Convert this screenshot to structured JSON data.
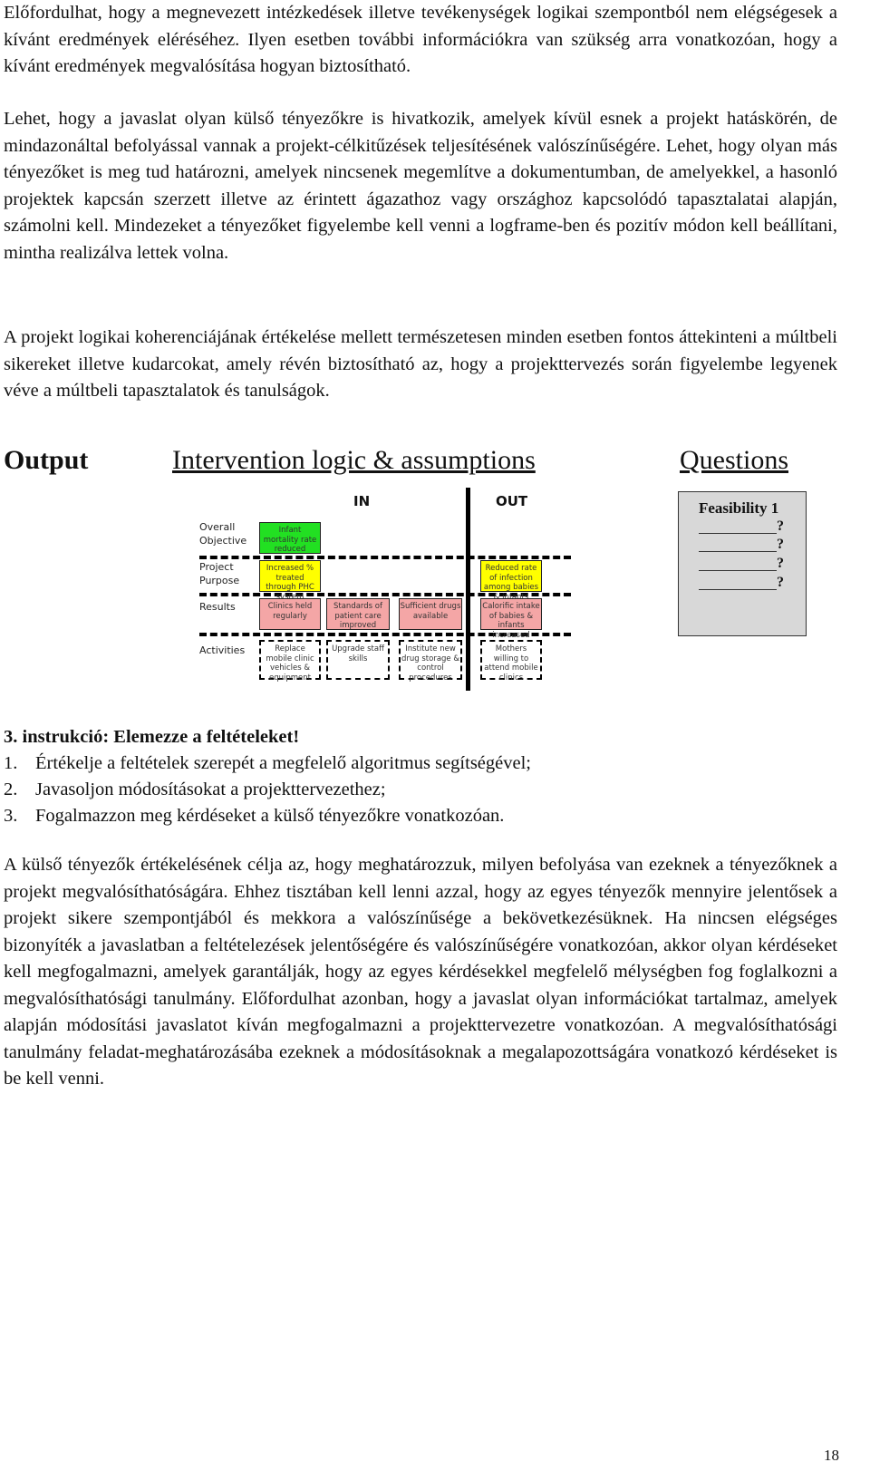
{
  "paragraphs": [
    "Előfordulhat, hogy a megnevezett intézkedések illetve tevékenységek logikai szempontból nem elégségesek a kívánt eredmények eléréséhez. Ilyen esetben további információkra van szükség arra vonatkozóan, hogy a kívánt eredmények megvalósítása hogyan biztosítható.",
    "Lehet, hogy a javaslat olyan külső tényezőkre is hivatkozik, amelyek kívül esnek a projekt hatáskörén, de mindazonáltal befolyással vannak a projekt-célkitűzések teljesítésének valószínűségére. Lehet, hogy olyan más tényezőket is meg tud határozni, amelyek nincsenek megemlítve a dokumentumban, de amelyekkel, a hasonló projektek kapcsán szerzett illetve az érintett ágazathoz vagy országhoz kapcsolódó tapasztalatai alapján, számolni kell. Mindezeket a tényezőket figyelembe kell venni a logframe-ben és pozitív módon kell beállítani, mintha realizálva lettek volna.",
    "A projekt logikai koherenciájának értékelése mellett természetesen minden esetben fontos áttekinteni a múltbeli sikereket illetve kudarcokat, amely révén biztosítható az, hogy a projekttervezés során figyelembe legyenek véve a múltbeli tapasztalatok és tanulságok."
  ],
  "figure": {
    "output_heading": "Output",
    "logic_heading": "Intervention logic & assumptions",
    "questions_heading": "Questions",
    "col_in": "IN",
    "col_out": "OUT",
    "row_labels": {
      "overall_objective": "Overall\nObjective",
      "project_purpose": "Project\nPurpose",
      "results": "Results",
      "activities": "Activities"
    },
    "boxes": {
      "objective_in": "Infant mortality rate reduced",
      "purpose_in": "Increased % treated through PHC system",
      "purpose_out": "Reduced rate of infection among babies & infants",
      "result_1": "Clinics held regularly",
      "result_2": "Standards of patient care improved",
      "result_3": "Sufficient drugs available",
      "result_out": "Calorific intake of babies & infants increased",
      "activity_1": "Replace mobile clinic vehicles & equipment",
      "activity_2": "Upgrade staff skills",
      "activity_3": "Institute new drug storage & control procedures",
      "activity_out": "Mothers willing to attend mobile clinics"
    },
    "questions_box": {
      "title": "Feasibility 1",
      "mark": "?"
    }
  },
  "instruction": {
    "title": "3. instrukció: Elemezze a feltételeket!",
    "items": [
      {
        "num": "1.",
        "text": "Értékelje a feltételek szerepét a megfelelő algoritmus segítségével;"
      },
      {
        "num": "2.",
        "text": "Javasoljon módosításokat a projekttervezethez;"
      },
      {
        "num": "3.",
        "text": "Fogalmazzon meg kérdéseket a külső tényezőkre vonatkozóan."
      }
    ]
  },
  "paragraph_final": "A külső tényezők értékelésének célja az, hogy meghatározzuk, milyen befolyása van ezeknek a tényezőknek a projekt megvalósíthatóságára. Ehhez tisztában kell lenni azzal, hogy az egyes tényezők mennyire jelentősek a projekt sikere szempontjából és mekkora a valószínűsége a bekövetkezésüknek. Ha nincsen elégséges bizonyíték a javaslatban a feltételezések jelentőségére és valószínűségére vonatkozóan, akkor olyan kérdéseket kell megfogalmazni, amelyek garantálják, hogy az egyes kérdésekkel megfelelő mélységben fog foglalkozni a megvalósíthatósági tanulmány. Előfordulhat azonban, hogy a javaslat olyan információkat tartalmaz, amelyek alapján módosítási javaslatot kíván megfogalmazni a projekttervezetre vonatkozóan. A megvalósíthatósági tanulmány feladat-meghatározásába ezeknek a módosításoknak a megalapozottságára vonatkozó kérdéseket is be kell venni.",
  "page_number": "18"
}
